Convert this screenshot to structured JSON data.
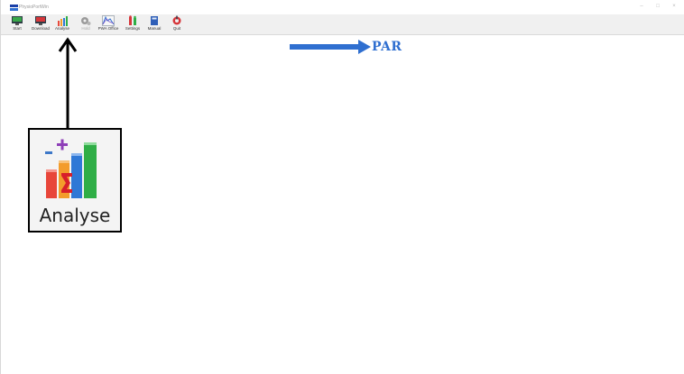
{
  "window": {
    "title": "PhysioPortWin",
    "controls": [
      "minimize-icon",
      "maximize-icon",
      "close-icon"
    ]
  },
  "toolbar": {
    "buttons": [
      {
        "label": "Start",
        "icon": "monitor-start-icon",
        "enabled": true
      },
      {
        "label": "Download",
        "icon": "monitor-download-icon",
        "enabled": true
      },
      {
        "label": "Analyse",
        "icon": "bar-chart-sigma-icon",
        "enabled": true
      },
      {
        "label": "Hold",
        "icon": "gears-icon",
        "enabled": false
      },
      {
        "label": "PWA Office",
        "icon": "pulse-wave-icon",
        "enabled": true
      },
      {
        "label": "Settings",
        "icon": "settings-figures-icon",
        "enabled": true
      },
      {
        "label": "Manual",
        "icon": "manual-book-icon",
        "enabled": true
      },
      {
        "label": "Quit",
        "icon": "quit-icon",
        "enabled": true
      }
    ]
  },
  "logo": {
    "text": "PAR",
    "color": "#2f6fd0"
  },
  "callout": {
    "label": "Analyse",
    "icon": "bar-chart-sigma-icon",
    "arrow": "arrow-up-icon"
  },
  "colors": {
    "accent": "#2f6fd0",
    "toolbar_bg": "#f0f0f0",
    "callout_border": "#000000"
  }
}
